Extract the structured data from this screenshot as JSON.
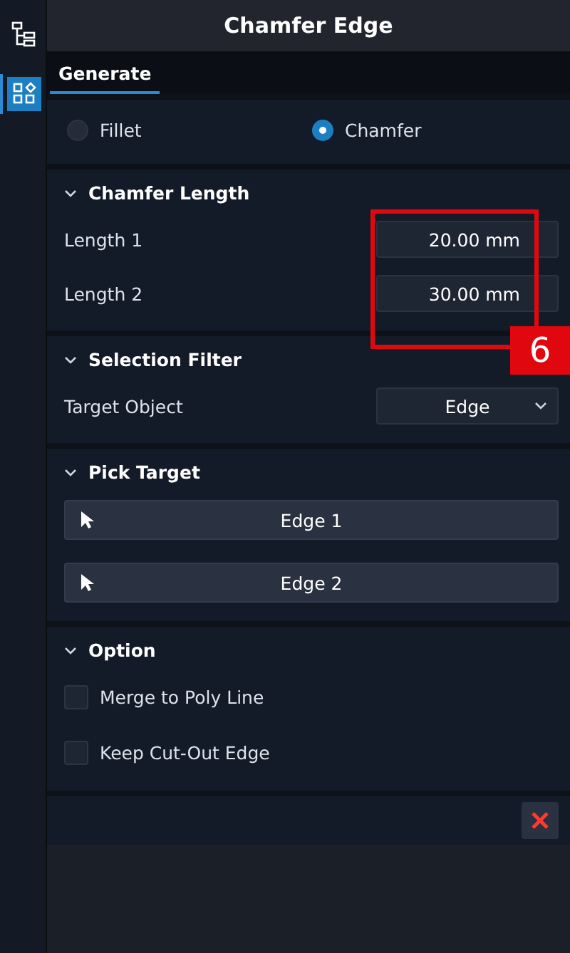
{
  "sidebar": {
    "items": [
      {
        "kind": "tree",
        "selected": false
      },
      {
        "kind": "blocks",
        "selected": true
      }
    ]
  },
  "title": "Chamfer Edge",
  "tabs": [
    {
      "label": "Generate",
      "selected": true
    }
  ],
  "mode": [
    {
      "label": "Fillet",
      "selected": false
    },
    {
      "label": "Chamfer",
      "selected": true
    }
  ],
  "chamfer_length": {
    "title": "Chamfer Length",
    "expanded": true,
    "fields": [
      {
        "label": "Length 1",
        "value": "20.00 mm"
      },
      {
        "label": "Length 2",
        "value": "30.00 mm"
      }
    ]
  },
  "selection_filter": {
    "title": "Selection Filter",
    "expanded": true,
    "label": "Target Object",
    "value": "Edge"
  },
  "pick_target": {
    "title": "Pick Target",
    "expanded": true,
    "buttons": [
      "Edge 1",
      "Edge 2"
    ]
  },
  "option": {
    "title": "Option",
    "expanded": true,
    "checkboxes": [
      {
        "label": "Merge to Poly Line",
        "checked": false
      },
      {
        "label": "Keep Cut-Out Edge",
        "checked": false
      }
    ]
  },
  "callout": {
    "label": "6"
  }
}
